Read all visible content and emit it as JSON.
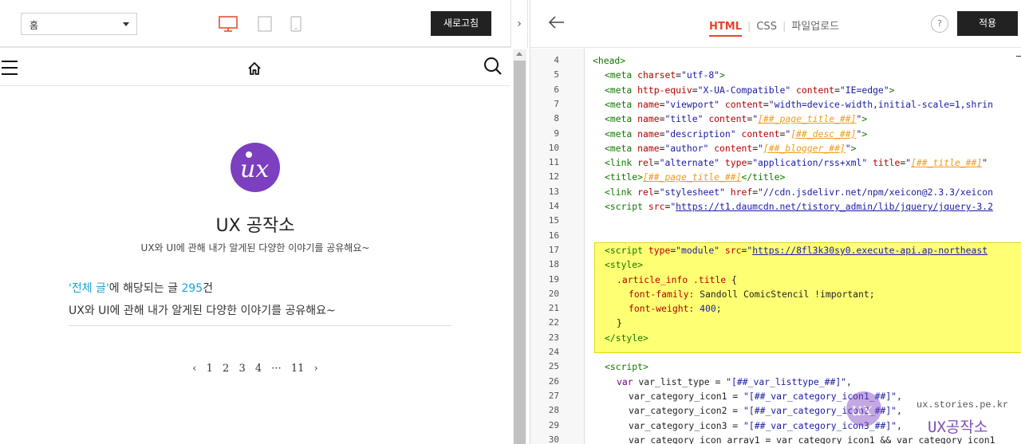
{
  "toolbar": {
    "category_select": "홈",
    "refresh_label": "새로고침",
    "collapse_arrow": "›"
  },
  "preview": {
    "blog_title": "UX 공작소",
    "blog_desc": "UX와 UI에 관해 내가 알게된 다양한 이야기를 공유해요~",
    "category_prefix": "'전체 글'",
    "category_mid": "에 해당되는 글 ",
    "category_count": "295",
    "category_suffix": "건",
    "category_desc": "UX와 UI에 관해 내가 알게된 다양한 이야기를 공유해요~",
    "pagination": {
      "prev": "‹",
      "pages": [
        "1",
        "2",
        "3",
        "4",
        "···",
        "11"
      ],
      "next": "›"
    }
  },
  "editor_toolbar": {
    "back": "←",
    "tabs": [
      "HTML",
      "CSS",
      "파일업로드"
    ],
    "active_tab": "HTML",
    "help": "?",
    "apply_label": "적용"
  },
  "code_lines": [
    {
      "n": "4",
      "indent": 0,
      "html": "<span class='tag'>&lt;head&gt;</span>"
    },
    {
      "n": "5",
      "indent": 1,
      "html": "<span class='tag'>&lt;meta</span> <span class='attr'>charset</span>=<span class='str'>\"utf-8\"</span><span class='tag'>&gt;</span>"
    },
    {
      "n": "6",
      "indent": 1,
      "html": "<span class='tag'>&lt;meta</span> <span class='attr'>http-equiv</span>=<span class='str'>\"X-UA-Compatible\"</span> <span class='attr'>content</span>=<span class='str'>\"IE=edge\"</span><span class='tag'>&gt;</span>"
    },
    {
      "n": "7",
      "indent": 1,
      "html": "<span class='tag'>&lt;meta</span> <span class='attr'>name</span>=<span class='str'>\"viewport\"</span> <span class='attr'>content</span>=<span class='str'>\"width=device-width,initial-scale=1,shrin</span>"
    },
    {
      "n": "8",
      "indent": 1,
      "html": "<span class='tag'>&lt;meta</span> <span class='attr'>name</span>=<span class='str'>\"title\"</span> <span class='attr'>content</span>=<span class='str'>\"<span class='ph'>[##_page_title_##]</span>\"</span><span class='tag'>&gt;</span>"
    },
    {
      "n": "9",
      "indent": 1,
      "html": "<span class='tag'>&lt;meta</span> <span class='attr'>name</span>=<span class='str'>\"description\"</span> <span class='attr'>content</span>=<span class='str'>\"<span class='ph'>[##_desc_##]</span>\"</span><span class='tag'>&gt;</span>"
    },
    {
      "n": "10",
      "indent": 1,
      "html": "<span class='tag'>&lt;meta</span> <span class='attr'>name</span>=<span class='str'>\"author\"</span> <span class='attr'>content</span>=<span class='str'>\"<span class='ph'>[##_blogger_##]</span>\"</span><span class='tag'>&gt;</span>"
    },
    {
      "n": "11",
      "indent": 1,
      "html": "<span class='tag'>&lt;link</span> <span class='attr'>rel</span>=<span class='str'>\"alternate\"</span> <span class='attr'>type</span>=<span class='str'>\"application/rss+xml\"</span> <span class='attr'>title</span>=<span class='str'>\"<span class='ph'>[##_title_##]</span>\"</span>"
    },
    {
      "n": "12",
      "indent": 1,
      "html": "<span class='tag'>&lt;title&gt;</span><span class='ph'>[##_page_title_##]</span><span class='tag'>&lt;/title&gt;</span>"
    },
    {
      "n": "13",
      "indent": 1,
      "html": "<span class='tag'>&lt;link</span> <span class='attr'>rel</span>=<span class='str'>\"stylesheet\"</span> <span class='attr'>href</span>=<span class='str'>\"//cdn.jsdelivr.net/npm/xeicon@2.3.3/xeicon</span>"
    },
    {
      "n": "14",
      "indent": 1,
      "html": "<span class='tag'>&lt;script</span> <span class='attr'>src</span>=<span class='str'>\"<span class='url'>https://t1.daumcdn.net/tistory_admin/lib/jquery/jquery-3.2</span></span>"
    },
    {
      "n": "15",
      "indent": 0,
      "html": ""
    },
    {
      "n": "16",
      "indent": 0,
      "html": ""
    },
    {
      "n": "17",
      "indent": 1,
      "html": "<span class='tag'>&lt;script</span> <span class='attr'>type</span>=<span class='str'>\"module\"</span> <span class='attr'>src</span>=<span class='str'>\"<span class='url'>https://8fl3k30sy0.execute-api.ap-northeast</span></span>"
    },
    {
      "n": "18",
      "indent": 1,
      "html": "<span class='tag'>&lt;style&gt;</span>"
    },
    {
      "n": "19",
      "indent": 2,
      "html": "<span class='attr'>.article_info</span> <span class='attr'>.title</span> {"
    },
    {
      "n": "20",
      "indent": 3,
      "html": "<span class='attr'>font-family:</span> Sandoll ComicStencil !important;"
    },
    {
      "n": "21",
      "indent": 3,
      "html": "<span class='attr'>font-weight:</span> <span class='str'>400</span>;"
    },
    {
      "n": "22",
      "indent": 2,
      "html": "}"
    },
    {
      "n": "23",
      "indent": 1,
      "html": "<span class='tag'>&lt;/style&gt;</span>"
    },
    {
      "n": "24",
      "indent": 0,
      "html": ""
    },
    {
      "n": "25",
      "indent": 1,
      "html": "<span class='tag'>&lt;script&gt;</span>"
    },
    {
      "n": "26",
      "indent": 2,
      "html": "<span class='kw'>var</span> var_list_type = <span class='str'>\"[##_var_listtype_##]\"</span>,"
    },
    {
      "n": "27",
      "indent": 3,
      "html": "var_category_icon1 = <span class='str'>\"[##_var_category_icon1_##]\"</span>,"
    },
    {
      "n": "28",
      "indent": 3,
      "html": "var_category_icon2 = <span class='str'>\"[##_var_category_icon2_##]\"</span>,"
    },
    {
      "n": "29",
      "indent": 3,
      "html": "var_category_icon3 = <span class='str'>\"[##_var_category_icon3_##]\"</span>,"
    },
    {
      "n": "30",
      "indent": 3,
      "html": "var_category_icon_array1 = var_category_icon1 &amp;&amp; var_category_icon1"
    }
  ],
  "watermark": {
    "site": "ux.stories.pe.kr",
    "brand": "UX공작소"
  },
  "colors": {
    "accent_red": "#e7442b",
    "logo_purple": "#7c3fbf",
    "highlight_yellow": "#ffff74",
    "link_blue": "#1ba1d9"
  }
}
